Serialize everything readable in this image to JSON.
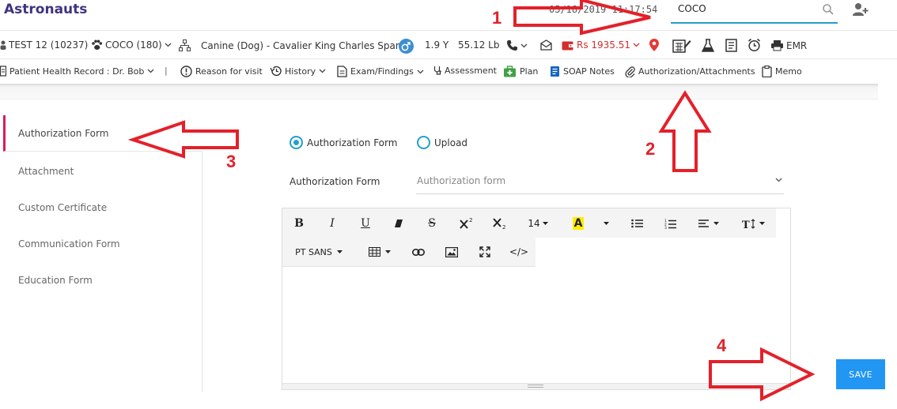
{
  "app": {
    "title": "Astronauts",
    "datetime": "05/18/2019 11:17:54"
  },
  "search": {
    "value": "COCO",
    "placeholder": ""
  },
  "patient_bar": {
    "client": "TEST 12 (10237)",
    "patient": "COCO (180)",
    "breed": "Canine (Dog) - Cavalier King Charles Spaniel",
    "age": "1.9 Y",
    "weight": "55.12 Lb",
    "balance": "Rs 1935.51",
    "emr_label": "EMR"
  },
  "nav": {
    "patient_record": "Patient Health Record : Dr. Bob",
    "separator": "|",
    "reason": "Reason for visit",
    "history": "History",
    "exam": "Exam/Findings",
    "assessment": "Assessment",
    "plan": "Plan",
    "soap": "SOAP Notes",
    "authorization": "Authorization/Attachments",
    "memo": "Memo"
  },
  "sidebar": {
    "items": [
      {
        "label": "Authorization Form",
        "active": true
      },
      {
        "label": "Attachment"
      },
      {
        "label": "Custom Certificate"
      },
      {
        "label": "Communication Form"
      },
      {
        "label": "Education Form"
      }
    ]
  },
  "form": {
    "radio_authorization": "Authorization Form",
    "radio_upload": "Upload",
    "field_label": "Authorization Form",
    "select_value": "Authorization form"
  },
  "editor": {
    "font_size": "14",
    "font_family": "PT SANS",
    "bold": "B",
    "italic": "I",
    "underline": "U",
    "strike": "S",
    "highlight": "A",
    "code": "</>"
  },
  "save_label": "SAVE",
  "annotations": [
    "1",
    "2",
    "3",
    "4"
  ],
  "colors": {
    "brand": "#3d3580",
    "accent": "#26a0c9",
    "save": "#2196f3",
    "annotation": "#e4202a",
    "balance": "#d32f2f"
  }
}
